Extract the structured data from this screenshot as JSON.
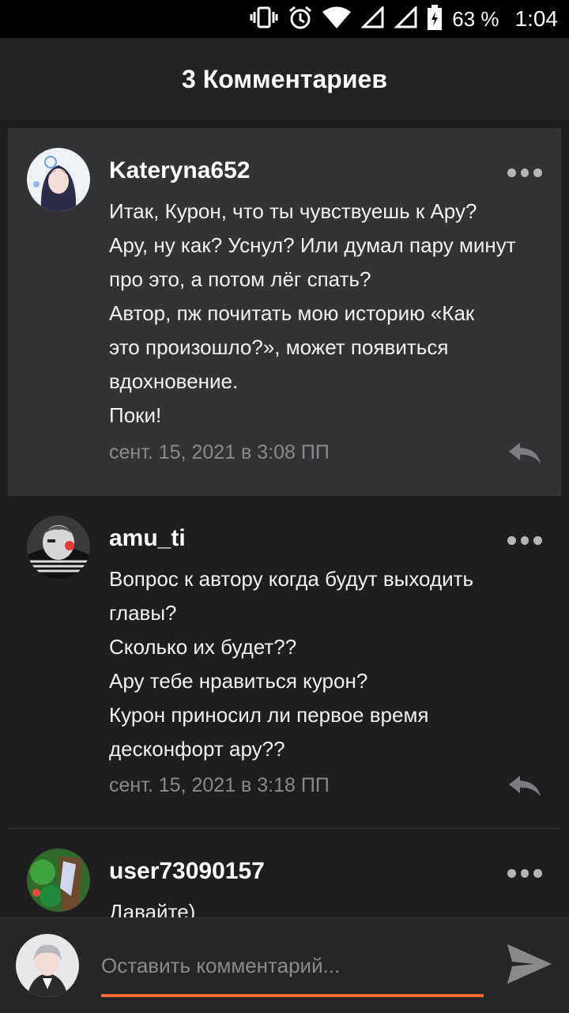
{
  "status_bar": {
    "battery_percent": "63 %",
    "time": "1:04",
    "icons": [
      "vibrate-icon",
      "alarm-icon",
      "wifi-icon",
      "signal-icon",
      "signal-icon",
      "battery-icon"
    ]
  },
  "header": {
    "title": "3 Комментариев"
  },
  "comments": [
    {
      "username": "Kateryna652",
      "lines": [
        "Итак, Курон, что ты чувствуешь к Ару?",
        "Ару, ну как? Уснул? Или думал пару минут",
        "про это, а потом лёг спать?",
        "Автор, пж почитать мою историю «Как",
        "это произошло?», может появиться",
        "вдохновение.",
        "Поки!"
      ],
      "date": "сент. 15, 2021 в 3:08 ПП",
      "highlighted": true
    },
    {
      "username": "amu_ti",
      "lines": [
        "Вопрос к автору когда будут выходить",
        "главы?",
        "Сколько их будет??",
        "Ару тебе нравиться курон?",
        "Курон приносил ли первое время",
        "десконфорт ару??"
      ],
      "date": "сент. 15, 2021 в 3:18 ПП",
      "highlighted": false
    },
    {
      "username": "user73090157",
      "lines": [
        "Давайте)"
      ],
      "date": "",
      "highlighted": false
    }
  ],
  "composer": {
    "placeholder": "Оставить комментарий..."
  },
  "colors": {
    "accent": "#ef6a2f",
    "background": "#1e1d1f",
    "highlight": "#333234"
  }
}
